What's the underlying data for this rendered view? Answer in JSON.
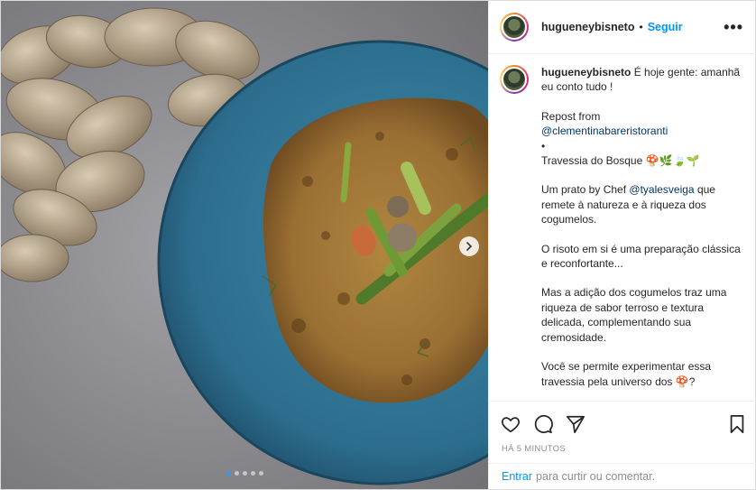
{
  "header": {
    "username": "hugueneybisneto",
    "separator": "•",
    "follow_label": "Seguir",
    "more_label": "•••"
  },
  "caption": {
    "username": "hugueneybisneto",
    "line1": "É hoje gente: amanhã eu conto tudo !",
    "repost_label": "Repost from",
    "repost_account": "@clementinabareristoranti",
    "bullet": "•",
    "title": "Travessia do Bosque 🍄🌿🍃🌱",
    "p1_before": "Um prato by Chef",
    "p1_mention": "@tyalesveiga",
    "p1_after": "que remete à natureza e à riqueza dos cogumelos.",
    "p2": "O risoto em si é uma preparação clássica e reconfortante...",
    "p3": "Mas a adição dos cogumelos traz uma riqueza de sabor terroso e textura delicada, complementando sua cremosidade.",
    "p4": "Você se permite experimentar essa travessia pela universo dos 🍄?"
  },
  "actions": {
    "like_icon": "heart-icon",
    "comment_icon": "comment-icon",
    "share_icon": "share-icon",
    "save_icon": "bookmark-icon"
  },
  "timestamp": "HÁ 5 MINUTOS",
  "comment_bar": {
    "login_label": "Entrar",
    "rest_label": "para curtir ou comentar."
  },
  "carousel": {
    "total_slides": 5,
    "active_index": 0,
    "next_icon": "chevron-right-icon"
  },
  "colors": {
    "accent": "#0095f6",
    "plate": "#2f6f8f",
    "table": "#8f8f93"
  }
}
